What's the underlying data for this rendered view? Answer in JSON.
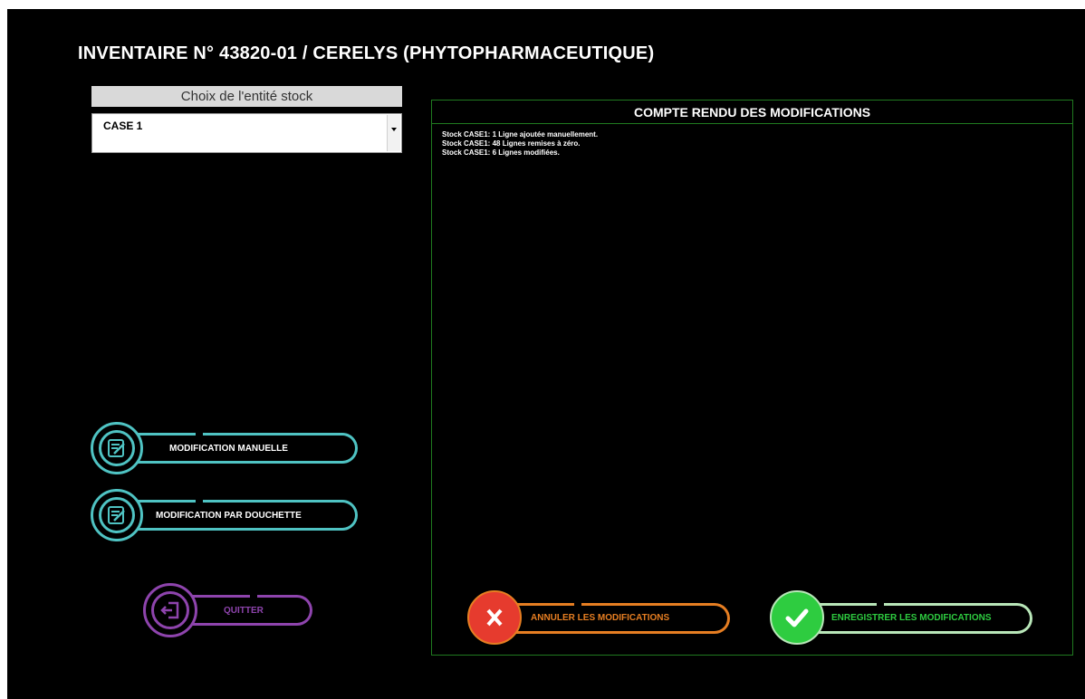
{
  "window": {
    "title": "INVENTAIRE N° 43820-01 / CERELYS (PHYTOPHARMACEUTIQUE)"
  },
  "entity": {
    "header": "Choix de l'entité stock",
    "selected": "CASE 1"
  },
  "report": {
    "title": "COMPTE RENDU DES MODIFICATIONS",
    "lines": [
      "Stock CASE1:  1 Ligne ajoutée manuellement.",
      "Stock CASE1:  48 Lignes remises à zéro.",
      "Stock CASE1:  6 Lignes modifiées."
    ]
  },
  "buttons": {
    "manual": "MODIFICATION MANUELLE",
    "scanner": "MODIFICATION PAR DOUCHETTE",
    "quit": "QUITTER",
    "cancel": "ANNULER LES MODIFICATIONS",
    "save": "ENREGISTRER LES MODIFICATIONS"
  },
  "colors": {
    "background": "#000000",
    "teal": "#4fc3c3",
    "purple": "#8e44ad",
    "orange": "#e67e22",
    "red": "#e63b2e",
    "green": "#2ecc40",
    "frame_green": "#1f7a1f"
  },
  "icons": {
    "manual": "edit-note-icon",
    "scanner": "edit-note-icon",
    "quit": "logout-icon",
    "cancel": "close-x-icon",
    "save": "checkmark-icon"
  }
}
